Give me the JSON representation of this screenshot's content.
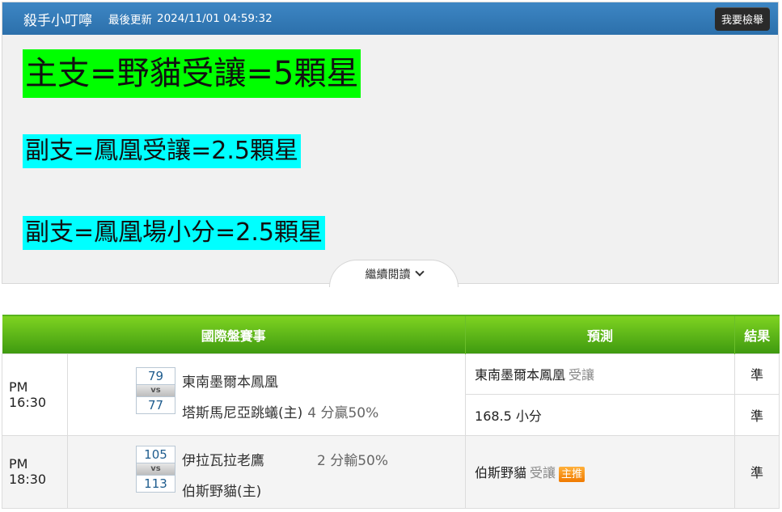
{
  "article": {
    "author": "殺手小叮嚀",
    "updated_label": "最後更新",
    "updated_value": "2024/11/01 04:59:32",
    "report_button": "我要檢舉",
    "tips": [
      "主支=野貓受讓=5顆星",
      "副支=鳳凰受讓=2.5顆星",
      "副支=鳳凰場小分=2.5顆星"
    ],
    "read_more": "繼續閱讀"
  },
  "table": {
    "headers": [
      "國際盤賽事",
      "預測",
      "結果"
    ],
    "vs_label": "vs",
    "games": [
      {
        "time": "PM 16:30",
        "score_top": "79",
        "score_bottom": "77",
        "team_top": "東南墨爾本鳳凰",
        "team_bottom": "塔斯馬尼亞跳蟻(主)",
        "odds": "4 分贏50%",
        "predictions": [
          {
            "pick": "東南墨爾本鳳凰",
            "hint": "受讓",
            "result": "準"
          },
          {
            "pick": "168.5 小分",
            "hint": "",
            "result": "準"
          }
        ]
      },
      {
        "time": "PM 18:30",
        "score_top": "105",
        "score_bottom": "113",
        "team_top": "伊拉瓦拉老鷹",
        "team_bottom": "伯斯野貓(主)",
        "odds": "2 分輸50%",
        "predictions": [
          {
            "pick": "伯斯野貓",
            "hint": "受讓",
            "badge": "主推",
            "result": "準"
          }
        ]
      }
    ]
  },
  "colors": {
    "header_blue": "#2c70ab",
    "main_tip_bg": "#00ff00",
    "sub_tip_bg": "#00ffff",
    "table_header_green": "#4caf1a",
    "result_green": "#1c8a1c",
    "badge_orange": "#f07a00"
  }
}
